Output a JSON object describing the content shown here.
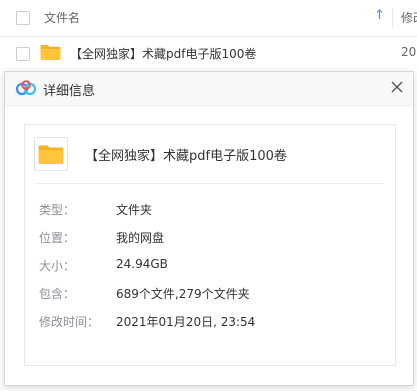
{
  "file_list": {
    "header": {
      "name_label": "文件名",
      "sort_icon": "↑",
      "modified_label": "修改"
    },
    "rows": [
      {
        "name": "【全网独家】术藏pdf电子版100卷",
        "date": "20"
      }
    ]
  },
  "dialog": {
    "title": "详细信息",
    "file_name": "【全网独家】术藏pdf电子版100卷",
    "properties": [
      {
        "label": "类型：",
        "value": "文件夹"
      },
      {
        "label": "位置：",
        "value": "我的网盘"
      },
      {
        "label": "大小：",
        "value": "24.94GB"
      },
      {
        "label": "包含：",
        "value": "689个文件,279个文件夹"
      },
      {
        "label": "修改时间：",
        "value": "2021年01月20日, 23:54"
      }
    ]
  },
  "colors": {
    "accent": "#3b8cff",
    "folder": "#ffc63d",
    "folder_tab": "#f5b221"
  },
  "icons": {
    "sort": "sort-ascending-icon",
    "folder": "folder-icon",
    "logo": "cloud-logo-icon",
    "close": "close-icon"
  }
}
